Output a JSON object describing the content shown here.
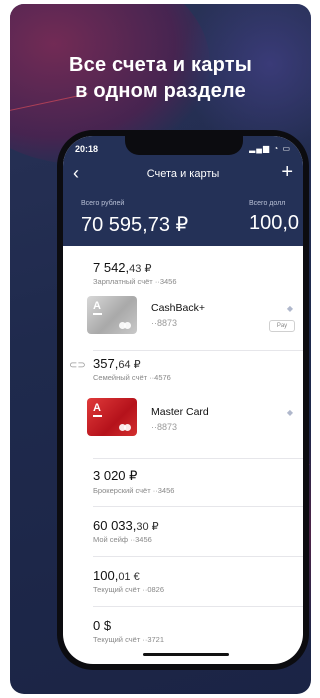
{
  "promo": {
    "headline_line1": "Все счета и карты",
    "headline_line2": "в одном разделе"
  },
  "status_bar": {
    "time": "20:18",
    "icons": "signal-icon wifi-icon battery-icon"
  },
  "nav": {
    "title": "Счета и карты",
    "back_icon": "chevron-left-icon",
    "add_icon": "plus-icon"
  },
  "totals": [
    {
      "label": "Всего рублей",
      "amount": "70 595,73 ₽"
    },
    {
      "label": "Всего долл",
      "amount": "100,0"
    }
  ],
  "accounts": [
    {
      "amount_main": "7 542,",
      "amount_frac": "43 ₽",
      "sub": "Зарплатный счёт ··3456"
    },
    {
      "amount_main": "357,",
      "amount_frac": "64 ₽",
      "sub": "Семейный счёт ··4576"
    },
    {
      "amount_main": "3 020 ₽",
      "amount_frac": "",
      "sub": "Брокерский счёт ··3456"
    },
    {
      "amount_main": "60 033,",
      "amount_frac": "30 ₽",
      "sub": "Мой сейф ··3456"
    },
    {
      "amount_main": "100,",
      "amount_frac": "01 €",
      "sub": "Текущий счёт ··0826"
    },
    {
      "amount_main": "0 $",
      "amount_frac": "",
      "sub": "Текущий счёт ··3721"
    }
  ],
  "cards": [
    {
      "name": "CashBack+",
      "number": "··8873",
      "badge": "Pay",
      "style": "gray"
    },
    {
      "name": "Master Card",
      "number": "··8873",
      "badge": "",
      "style": "red"
    }
  ],
  "brand": {
    "logo_letter": "А",
    "accent": "#ef3124",
    "header_bg": "#243157"
  }
}
